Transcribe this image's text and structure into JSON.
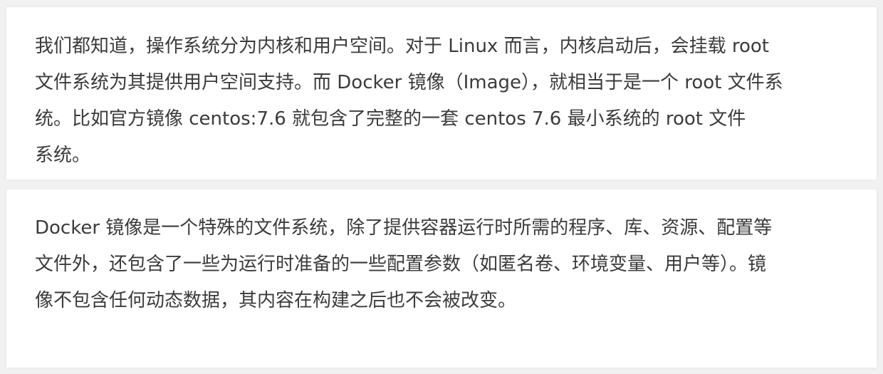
{
  "paragraphs": [
    {
      "lines": [
        "我们都知道，操作系统分为内核和用户空间。对于 Linux 而言，内核启动后，会挂载 root",
        "文件系统为其提供用户空间支持。而 Docker 镜像（Image），就相当于是一个 root 文件系",
        "统。比如官方镜像 centos:7.6 就包含了完整的一套 centos 7.6 最小系统的 root 文件",
        "系统。"
      ]
    },
    {
      "lines": [
        "Docker 镜像是一个特殊的文件系统，除了提供容器运行时所需的程序、库、资源、配置等",
        "文件外，还包含了一些为运行时准备的一些配置参数（如匿名卷、环境变量、用户等）。镜",
        "像不包含任何动态数据，其内容在构建之后也不会被改变。"
      ]
    }
  ],
  "colors": {
    "background": "#f1f1f1",
    "card": "#ffffff",
    "text": "#3b3b3b"
  }
}
